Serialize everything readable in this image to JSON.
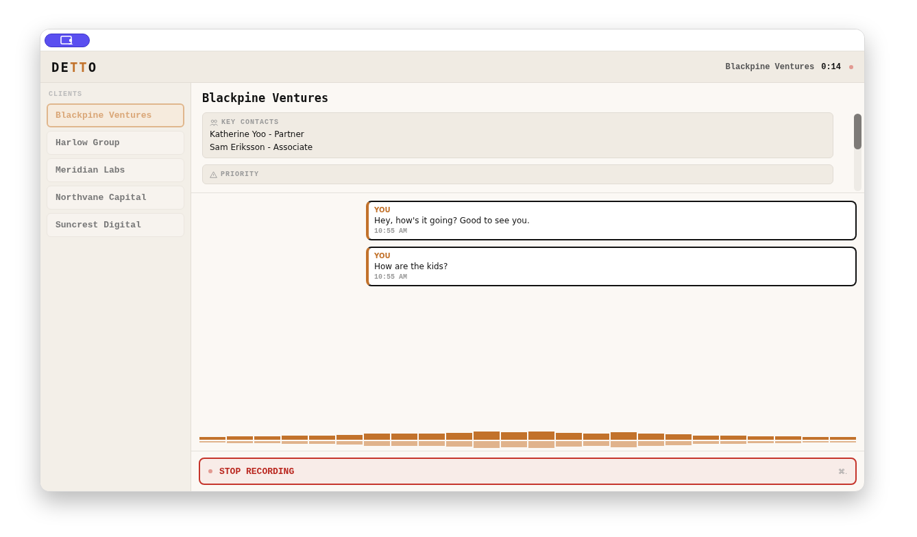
{
  "logo": {
    "parts": [
      {
        "text": "DE",
        "accent": false
      },
      {
        "text": "TT",
        "accent": true
      },
      {
        "text": "O",
        "accent": false
      }
    ]
  },
  "header": {
    "client": "Blackpine Ventures",
    "timer": "0:14",
    "recording": true
  },
  "sidebar": {
    "heading": "CLIENTS",
    "items": [
      {
        "label": "Blackpine Ventures",
        "selected": true
      },
      {
        "label": "Harlow Group",
        "selected": false
      },
      {
        "label": "Meridian Labs",
        "selected": false
      },
      {
        "label": "Northvane Capital",
        "selected": false
      },
      {
        "label": "Suncrest Digital",
        "selected": false
      }
    ]
  },
  "client_panel": {
    "title": "Blackpine Ventures",
    "sections": [
      {
        "kind": "contacts",
        "heading": "KEY CONTACTS",
        "lines": [
          "Katherine Yoo - Partner",
          "Sam Eriksson - Associate"
        ]
      },
      {
        "kind": "priority",
        "heading": "PRIORITY"
      }
    ]
  },
  "messages": [
    {
      "speaker": "YOU",
      "text": "Hey, how's it going? Good to see you.",
      "time": "10:55 AM"
    },
    {
      "speaker": "YOU",
      "text": "How are the kids?",
      "time": "10:55 AM"
    }
  ],
  "stop_button": {
    "label": "STOP RECORDING",
    "shortcut": "⌘."
  }
}
